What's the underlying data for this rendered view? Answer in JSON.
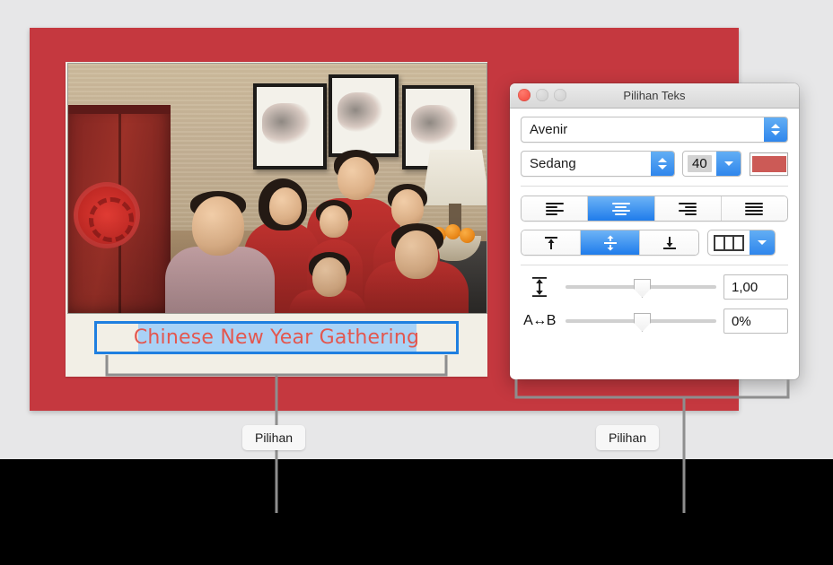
{
  "canvas": {
    "background_color": "#e7e7e8",
    "poster_color": "#c5383f",
    "mat_color": "#f2efe6",
    "photo_alt": "Family group portrait in a living room with red cabinet, framed artwork and lamp"
  },
  "text_box": {
    "text": "Chinese New Year Gathering",
    "text_color": "#e3574f",
    "selection_color": "#a9d2f6",
    "selection_border_color": "#1f7fe0",
    "state": "selected"
  },
  "dialog": {
    "title": "Pilihan Teks",
    "window_controls": [
      {
        "name": "close",
        "color": "#f2453a",
        "enabled": true
      },
      {
        "name": "minimize",
        "color": "#cccccc",
        "enabled": false
      },
      {
        "name": "zoom",
        "color": "#cccccc",
        "enabled": false
      }
    ],
    "font": {
      "family_value": "Avenir",
      "style_value": "Sedang",
      "size_value": "40",
      "color_swatch": "#cc5a56"
    },
    "paragraph_alignment": {
      "options": [
        "align-left",
        "align-center",
        "align-right",
        "align-justify"
      ],
      "selected_index": 1
    },
    "vertical_alignment": {
      "options": [
        "align-top",
        "align-middle",
        "align-bottom"
      ],
      "selected_index": 1
    },
    "columns_button": {
      "icon": "columns-icon",
      "has_dropdown": true
    },
    "spacing": {
      "line_spacing": {
        "icon": "line-height-icon",
        "value": "1,00",
        "slider_percent": 50
      },
      "character_spacing": {
        "icon": "character-spacing-icon",
        "label_glyph": "A↔B",
        "value": "0%",
        "slider_percent": 50
      }
    },
    "accent_color": "#2f86ec"
  },
  "callouts": [
    {
      "id": "text-box-callout",
      "label": "Pilihan"
    },
    {
      "id": "dialog-callout",
      "label": "Pilihan"
    }
  ]
}
